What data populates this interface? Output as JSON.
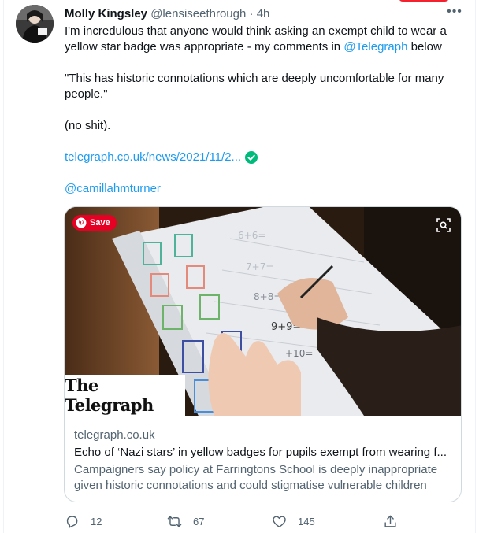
{
  "tweet": {
    "author_name": "Molly Kingsley",
    "author_handle": "@lensiseethrough",
    "separator": "·",
    "time": "4h",
    "more_label": "•••",
    "line1": "I'm incredulous that anyone would think asking an exempt child to wear a",
    "line2_pre": "yellow star badge was appropriate - my comments in ",
    "line2_mention": "@Telegraph",
    "line2_post": " below",
    "quote": "\"This has historic connotations which are deeply uncomfortable for many people.\"",
    "aside": "(no shit).",
    "url_text": "telegraph.co.uk/news/2021/11/2...",
    "mention2": "@camillahmturner"
  },
  "card": {
    "pin_label": "Save",
    "logo_text": "The Telegraph",
    "domain": "telegraph.co.uk",
    "title": "Echo of ‘Nazi stars’ in yellow badges for pupils exempt from wearing f...",
    "description": "Campaigners say policy at Farringtons School is deeply inappropriate given historic connotations and could stigmatise vulnerable children"
  },
  "actions": {
    "replies": "12",
    "retweets": "67",
    "likes": "145"
  },
  "colors": {
    "link": "#1d9bf0",
    "muted": "#536471",
    "verified": "#00ba7c",
    "pinterest": "#e60023"
  },
  "icons": [
    "reply-icon",
    "retweet-icon",
    "like-icon",
    "share-icon",
    "verified-check-icon",
    "pinterest-icon",
    "visual-search-icon",
    "more-icon"
  ]
}
